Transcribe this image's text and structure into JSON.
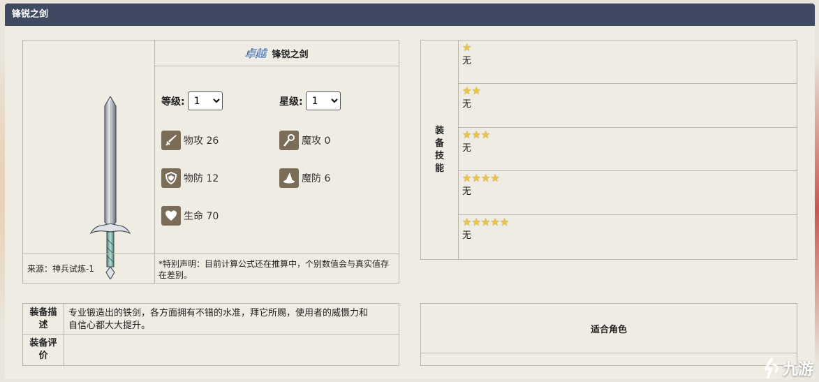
{
  "panel_title": "锋锐之剑",
  "equipment": {
    "rarity_badge": "卓越",
    "name": "锋锐之剑",
    "level_label": "等级:",
    "level_value": "1",
    "star_label": "星级:",
    "star_value": "1",
    "stats": [
      {
        "icon": "sword-icon",
        "label": "物攻 26"
      },
      {
        "icon": "wand-icon",
        "label": "魔攻 0"
      },
      {
        "icon": "shield-icon",
        "label": "物防 12"
      },
      {
        "icon": "wizard-hat-icon",
        "label": "魔防 6"
      },
      {
        "icon": "heart-icon",
        "label": "生命 70"
      }
    ],
    "source": "来源：神兵试炼-1",
    "disclaimer_line1": "*特别声明：目前计算公式还在推算中，个别数值会与真实值存",
    "disclaimer_line2": "在差别。"
  },
  "skills": {
    "header_chars": [
      "装",
      "备",
      "技",
      "能"
    ],
    "rows": [
      {
        "stars": 1,
        "text": "无"
      },
      {
        "stars": 2,
        "text": "无"
      },
      {
        "stars": 3,
        "text": "无"
      },
      {
        "stars": 4,
        "text": "无"
      },
      {
        "stars": 5,
        "text": "无"
      }
    ]
  },
  "description": {
    "label_line1": "装备描",
    "label_line2": "述",
    "text_line1": "专业锻造出的铁剑，各方面拥有不错的水准，拜它所赐，使用者的威慑力和",
    "text_line2": "自信心都大大提升。"
  },
  "evaluation": {
    "label_line1": "装备评",
    "label_line2": "价",
    "text": ""
  },
  "suitable_roles": {
    "header": "适合角色"
  },
  "watermark": {
    "text": "九游"
  },
  "colors": {
    "titlebar": "#3f4a62",
    "panel_bg": "#efece4",
    "border": "#b9b5ab",
    "star": "#e9c44a",
    "icon_bg": "#7b6c58"
  }
}
